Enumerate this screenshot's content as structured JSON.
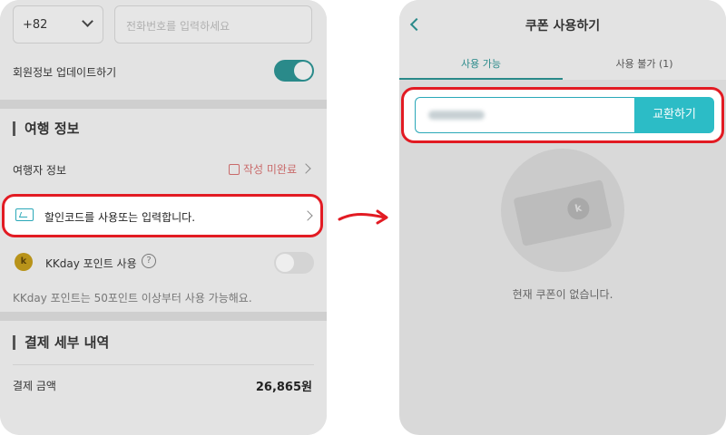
{
  "left_screen": {
    "country_code": "+82",
    "phone_placeholder": "전화번호를 입력하세요",
    "member_update_label": "회원정보 업데이트하기",
    "travel_section_title": "여행 정보",
    "traveler_info_label": "여행자 정보",
    "traveler_info_status": "작성 미완료",
    "coupon_row_text": "할인코드를 사용또는 입력합니다.",
    "points_label": "KKday 포인트 사용",
    "points_coin": "k",
    "points_help": "?",
    "points_note": "KKday 포인트는 50포인트 이상부터 사용 가능해요.",
    "payment_section_title": "결제 세부 내역",
    "payment_amount_label": "결제 금액",
    "payment_amount": "26,865원"
  },
  "right_screen": {
    "title": "쿠폰 사용하기",
    "tabs": [
      {
        "label": "사용 가능",
        "active": true
      },
      {
        "label": "사용 불가 (1)",
        "active": false
      }
    ],
    "redeem_button": "교환하기",
    "empty_message": "현재 쿠폰이 없습니다.",
    "empty_badge": "k"
  },
  "colors": {
    "accent_teal": "#2cbcc6",
    "highlight_red": "#e21b23",
    "status_red": "#c96a6a"
  }
}
